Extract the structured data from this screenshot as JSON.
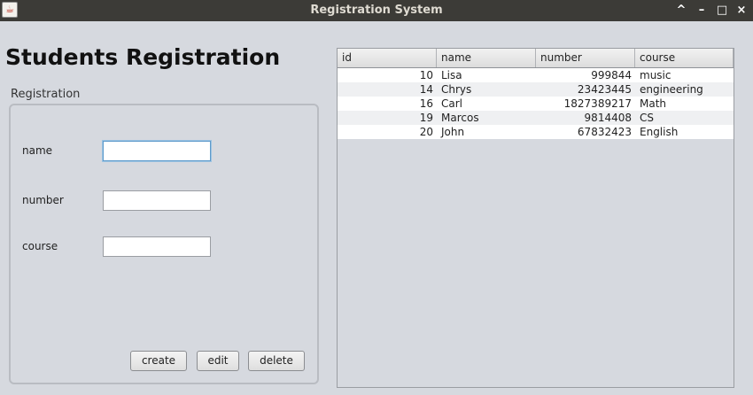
{
  "window": {
    "title": "Registration System",
    "app_icon": "java-icon",
    "controls": {
      "maximize": "^",
      "minimize": "–",
      "restore": "□",
      "close": "×"
    }
  },
  "form": {
    "heading": "Students Registration",
    "group_title": "Registration",
    "fields": [
      {
        "label": "name",
        "value": "",
        "placeholder": ""
      },
      {
        "label": "number",
        "value": "",
        "placeholder": ""
      },
      {
        "label": "course",
        "value": "",
        "placeholder": ""
      }
    ],
    "buttons": {
      "create": "create",
      "edit": "edit",
      "delete": "delete"
    }
  },
  "table": {
    "columns": [
      "id",
      "name",
      "number",
      "course"
    ],
    "rows": [
      [
        "10",
        "Lisa",
        "999844",
        "music"
      ],
      [
        "14",
        "Chrys",
        "23423445",
        "engineering"
      ],
      [
        "16",
        "Carl",
        "1827389217",
        "Math"
      ],
      [
        "19",
        "Marcos",
        "9814408",
        "CS"
      ],
      [
        "20",
        "John",
        "67832423",
        "English"
      ]
    ]
  },
  "colors": {
    "titlebar": "#3c3b37",
    "background": "#d6d9df",
    "row_even": "#ffffff",
    "row_odd": "#eff0f2",
    "focus_border": "#5e9acb"
  }
}
